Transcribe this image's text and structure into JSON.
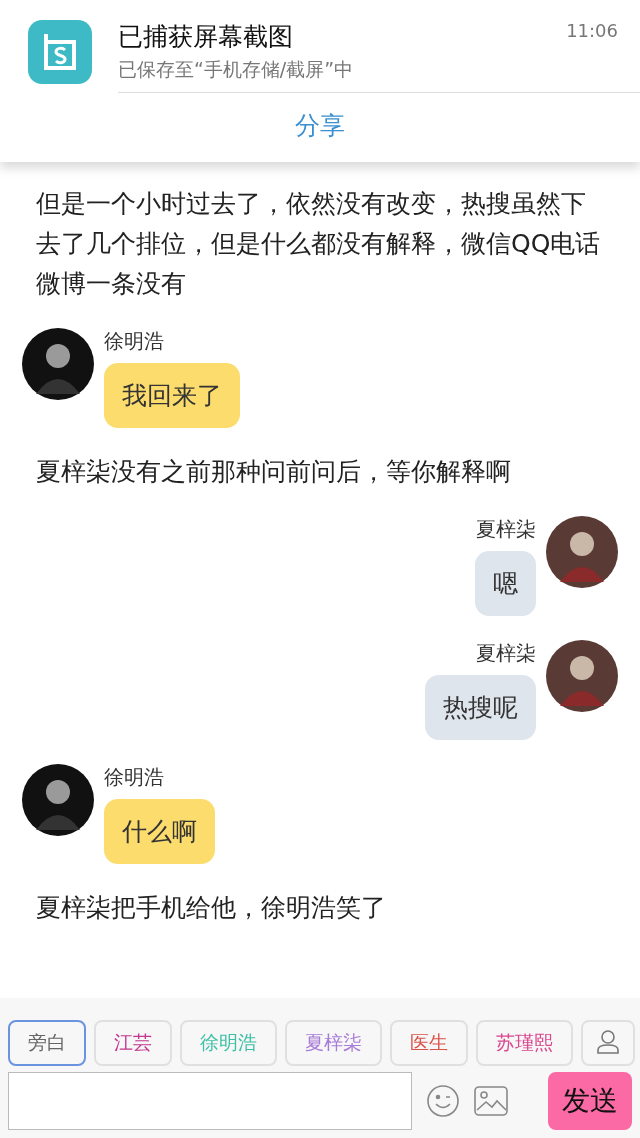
{
  "notification": {
    "title": "已捕获屏幕截图",
    "subtitle": "已保存至“手机存储/截屏”中",
    "time": "11:06",
    "action": "分享"
  },
  "messages": [
    {
      "kind": "narration",
      "text": "但是一个小时过去了，依然没有改变，热搜虽然下去了几个排位，但是什么都没有解释，微信QQ电话微博一条没有"
    },
    {
      "kind": "left",
      "name": "徐明浩",
      "text": "我回来了"
    },
    {
      "kind": "narration",
      "text": "夏梓柒没有之前那种问前问后，等你解释啊"
    },
    {
      "kind": "right",
      "name": "夏梓柒",
      "text": "嗯"
    },
    {
      "kind": "right",
      "name": "夏梓柒",
      "text": "热搜呢"
    },
    {
      "kind": "left",
      "name": "徐明浩",
      "text": "什么啊"
    },
    {
      "kind": "narration",
      "text": "夏梓柒把手机给他，徐明浩笑了"
    }
  ],
  "characters": [
    {
      "label": "旁白",
      "selected": true,
      "color": "#666666"
    },
    {
      "label": "江芸",
      "selected": false,
      "color": "#c2378f"
    },
    {
      "label": "徐明浩",
      "selected": false,
      "color": "#3dbfa6"
    },
    {
      "label": "夏梓柒",
      "selected": false,
      "color": "#a77bd8"
    },
    {
      "label": "医生",
      "selected": false,
      "color": "#d9534a"
    },
    {
      "label": "苏瑾熙",
      "selected": false,
      "color": "#d9478f"
    }
  ],
  "composer": {
    "send": "发送"
  }
}
